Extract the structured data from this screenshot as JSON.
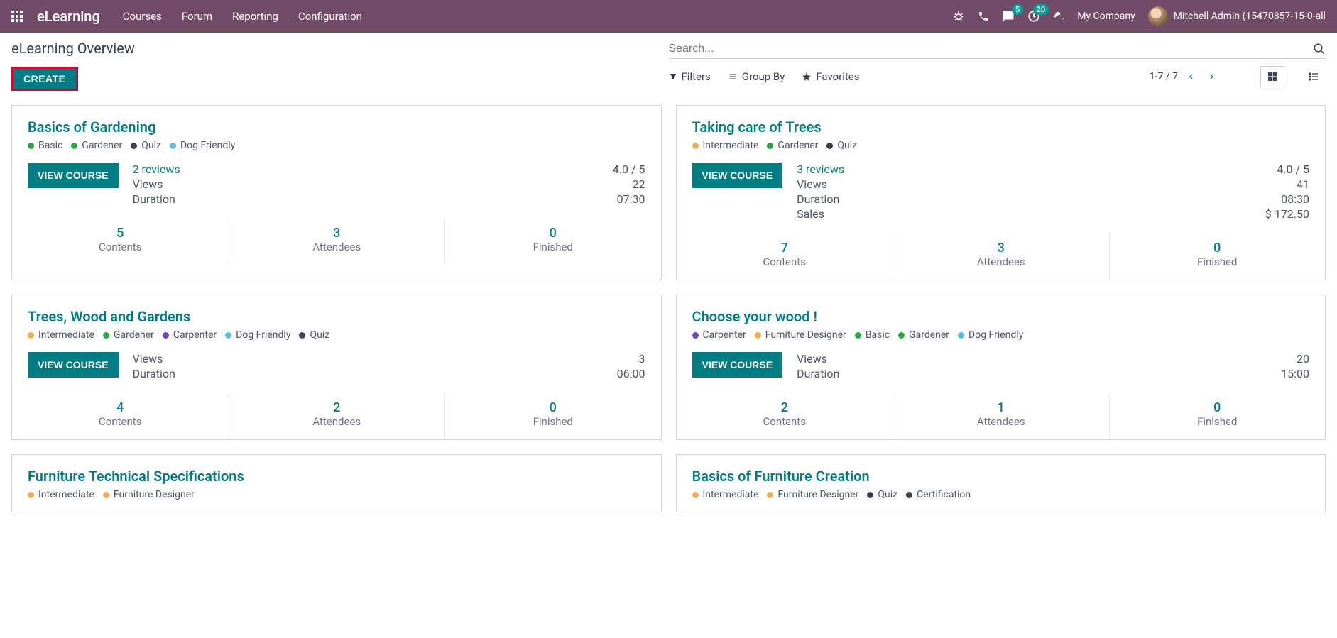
{
  "header": {
    "brand": "eLearning",
    "menu": [
      "Courses",
      "Forum",
      "Reporting",
      "Configuration"
    ],
    "messages_badge": "5",
    "activities_badge": "20",
    "company": "My Company",
    "user": "Mitchell Admin (15470857-15-0-all"
  },
  "page": {
    "title": "eLearning Overview",
    "create_label": "CREATE",
    "search_placeholder": "Search...",
    "filters_label": "Filters",
    "groupby_label": "Group By",
    "favorites_label": "Favorites",
    "pager": "1-7 / 7"
  },
  "tag_colors": {
    "Basic": "#28a745",
    "Gardener": "#28a745",
    "Quiz": "#374151",
    "Dog Friendly": "#5bc0de",
    "Intermediate": "#f0ad4e",
    "Carpenter": "#6f42c1",
    "Furniture Designer": "#f0ad4e",
    "Certification": "#374151"
  },
  "stat_labels": {
    "contents": "Contents",
    "attendees": "Attendees",
    "finished": "Finished",
    "views": "Views",
    "duration": "Duration",
    "sales": "Sales",
    "reviews_suffix": " reviews",
    "view_course": "VIEW COURSE"
  },
  "courses": [
    {
      "title": "Basics of Gardening",
      "tags": [
        "Basic",
        "Gardener",
        "Quiz",
        "Dog Friendly"
      ],
      "reviews": "2",
      "rating": "4.0 / 5",
      "views": "22",
      "duration": "07:30",
      "sales": null,
      "contents": "5",
      "attendees": "3",
      "finished": "0"
    },
    {
      "title": "Taking care of Trees",
      "tags": [
        "Intermediate",
        "Gardener",
        "Quiz"
      ],
      "reviews": "3",
      "rating": "4.0 / 5",
      "views": "41",
      "duration": "08:30",
      "sales": "$ 172.50",
      "contents": "7",
      "attendees": "3",
      "finished": "0"
    },
    {
      "title": "Trees, Wood and Gardens",
      "tags": [
        "Intermediate",
        "Gardener",
        "Carpenter",
        "Dog Friendly",
        "Quiz"
      ],
      "reviews": null,
      "rating": null,
      "views": "3",
      "duration": "06:00",
      "sales": null,
      "contents": "4",
      "attendees": "2",
      "finished": "0"
    },
    {
      "title": "Choose your wood !",
      "tags": [
        "Carpenter",
        "Furniture Designer",
        "Basic",
        "Gardener",
        "Dog Friendly"
      ],
      "reviews": null,
      "rating": null,
      "views": "20",
      "duration": "15:00",
      "sales": null,
      "contents": "2",
      "attendees": "1",
      "finished": "0"
    },
    {
      "title": "Furniture Technical Specifications",
      "tags": [
        "Intermediate",
        "Furniture Designer"
      ],
      "reviews": null,
      "rating": null,
      "views": null,
      "duration": null,
      "sales": null,
      "contents": null,
      "attendees": null,
      "finished": null
    },
    {
      "title": "Basics of Furniture Creation",
      "tags": [
        "Intermediate",
        "Furniture Designer",
        "Quiz",
        "Certification"
      ],
      "reviews": null,
      "rating": null,
      "views": null,
      "duration": null,
      "sales": null,
      "contents": null,
      "attendees": null,
      "finished": null
    }
  ]
}
